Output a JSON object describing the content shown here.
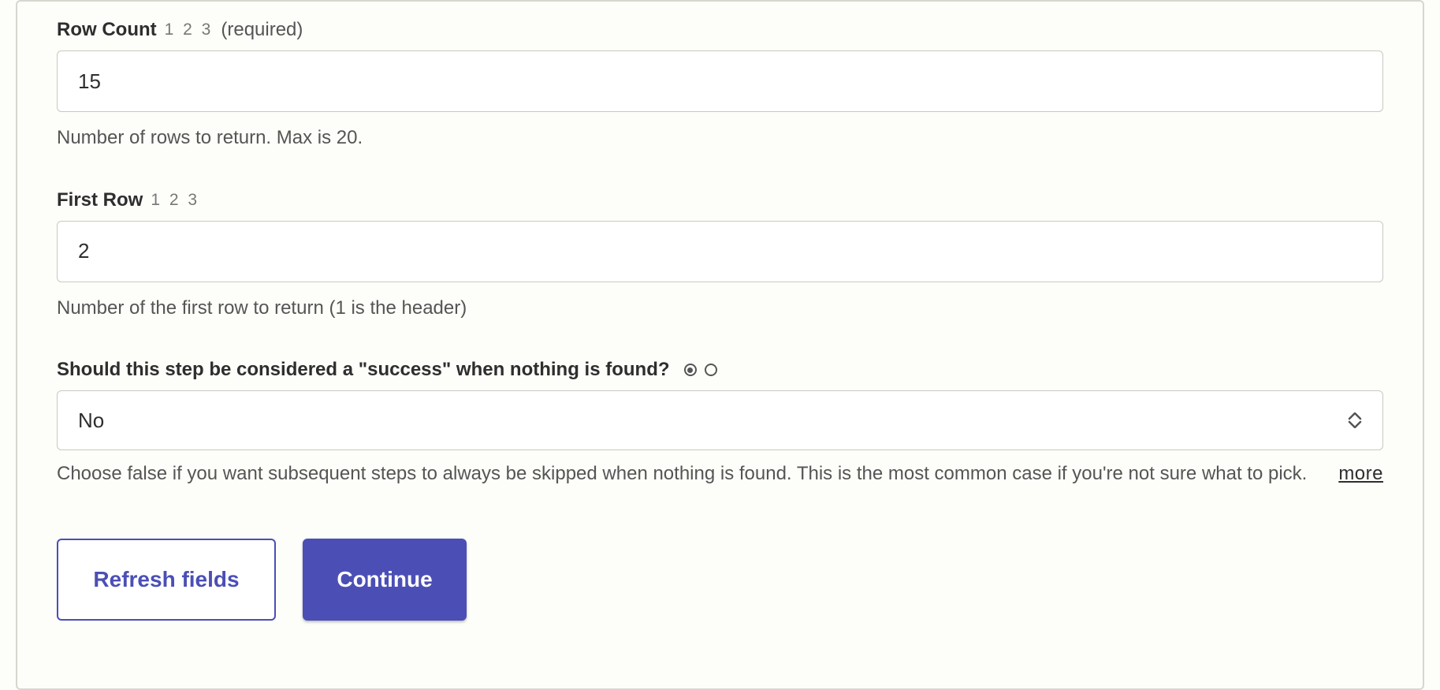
{
  "fields": {
    "rowCount": {
      "label": "Row Count",
      "typeHint": "1 2 3",
      "required": "(required)",
      "value": "15",
      "help": "Number of rows to return. Max is 20."
    },
    "firstRow": {
      "label": "First Row",
      "typeHint": "1 2 3",
      "value": "2",
      "help": "Number of the first row to return (1 is the header)"
    },
    "successWhenEmpty": {
      "label": "Should this step be considered a \"success\" when nothing is found?",
      "value": "No",
      "help": "Choose false if you want subsequent steps to always be skipped when nothing is found. This is the most common case if you're not sure what to pick.",
      "moreLabel": "more"
    }
  },
  "buttons": {
    "refresh": "Refresh fields",
    "continue": "Continue"
  }
}
